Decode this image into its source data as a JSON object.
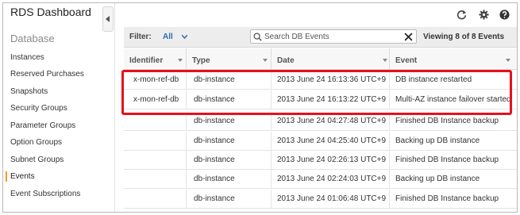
{
  "app": {
    "title": "RDS Dashboard"
  },
  "sidebar": {
    "heading": "Database",
    "items": [
      {
        "label": "Instances"
      },
      {
        "label": "Reserved Purchases"
      },
      {
        "label": "Snapshots"
      },
      {
        "label": "Security Groups"
      },
      {
        "label": "Parameter Groups"
      },
      {
        "label": "Option Groups"
      },
      {
        "label": "Subnet Groups"
      },
      {
        "label": "Events"
      },
      {
        "label": "Event Subscriptions"
      }
    ],
    "active": "Events"
  },
  "toolbar": {
    "icons": [
      "refresh-icon",
      "gear-icon",
      "help-icon"
    ]
  },
  "filter": {
    "label": "Filter:",
    "value": "All",
    "search_placeholder": "Search DB Events",
    "viewing": "Viewing 8 of 8 Events"
  },
  "table": {
    "columns": [
      "Identifier",
      "Type",
      "Date",
      "Event"
    ],
    "rows": [
      {
        "identifier": "x-mon-ref-db",
        "type": "db-instance",
        "date": "2013 June 24 16:13:36 UTC+9",
        "event": "DB instance restarted"
      },
      {
        "identifier": "x-mon-ref-db",
        "type": "db-instance",
        "date": "2013 June 24 16:13:22 UTC+9",
        "event": "Multi-AZ instance failover started"
      },
      {
        "identifier": "",
        "type": "db-instance",
        "date": "2013 June 24 04:27:48 UTC+9",
        "event": "Finished DB Instance backup"
      },
      {
        "identifier": "",
        "type": "db-instance",
        "date": "2013 June 24 04:25:40 UTC+9",
        "event": "Backing up DB instance"
      },
      {
        "identifier": "",
        "type": "db-instance",
        "date": "2013 June 24 02:26:13 UTC+9",
        "event": "Finished DB Instance backup"
      },
      {
        "identifier": "",
        "type": "db-instance",
        "date": "2013 June 24 02:24:03 UTC+9",
        "event": "Backing up DB instance"
      },
      {
        "identifier": "",
        "type": "db-instance",
        "date": "2013 June 24 01:06:48 UTC+9",
        "event": "Finished DB Instance backup"
      }
    ]
  },
  "colors": {
    "accent": "#2a6db1",
    "active_marker": "#f29c1f",
    "highlight": "#e8101b"
  }
}
